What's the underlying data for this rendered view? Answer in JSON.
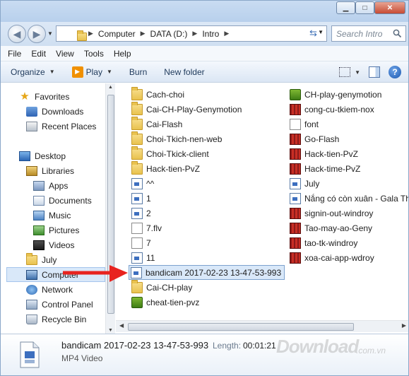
{
  "window": {
    "caption": {
      "minimize": "▁",
      "maximize": "□",
      "close": "✕"
    }
  },
  "address": {
    "crumbs": [
      "Computer",
      "DATA (D:)",
      "Intro"
    ],
    "search_placeholder": "Search Intro"
  },
  "menu": [
    "File",
    "Edit",
    "View",
    "Tools",
    "Help"
  ],
  "toolbar": {
    "organize": "Organize",
    "play": "Play",
    "burn": "Burn",
    "new_folder": "New folder"
  },
  "nav": {
    "favorites": "Favorites",
    "downloads": "Downloads",
    "recent_places": "Recent Places",
    "desktop": "Desktop",
    "libraries": "Libraries",
    "apps": "Apps",
    "documents": "Documents",
    "music": "Music",
    "pictures": "Pictures",
    "videos": "Videos",
    "july": "July",
    "computer": "Computer",
    "network": "Network",
    "control_panel": "Control Panel",
    "recycle_bin": "Recycle Bin"
  },
  "files_col1": [
    "Cach-choi",
    "Cai-CH-Play-Genymotion",
    "Cai-Flash",
    "Choi-Tkich-nen-web",
    "Choi-Tkick-client",
    "Hack-tien-PvZ",
    "^^",
    "1",
    "2",
    "7.flv",
    "7",
    "11",
    "bandicam 2017-02-23 13-47-53-993",
    "Cai-CH-play",
    "cheat-tien-pvz"
  ],
  "files_col2": [
    "CH-play-genymotion",
    "cong-cu-tkiem-nox",
    "font",
    "Go-Flash",
    "Hack-tien-PvZ",
    "Hack-time-PvZ",
    "July",
    "Nắng có còn xuân - Gala Th",
    "signin-out-windroy",
    "Tao-may-ao-Geny",
    "tao-tk-windroy",
    "xoa-cai-app-wdroy"
  ],
  "details": {
    "name": "bandicam 2017-02-23 13-47-53-993",
    "type": "MP4 Video",
    "length_label": "Length:",
    "length_value": "00:01:21"
  },
  "watermark": {
    "brand": "Download",
    "domain": ".com.vn"
  },
  "colors": {
    "selection": "#d9e8f9",
    "arrow": "#e8231f"
  }
}
